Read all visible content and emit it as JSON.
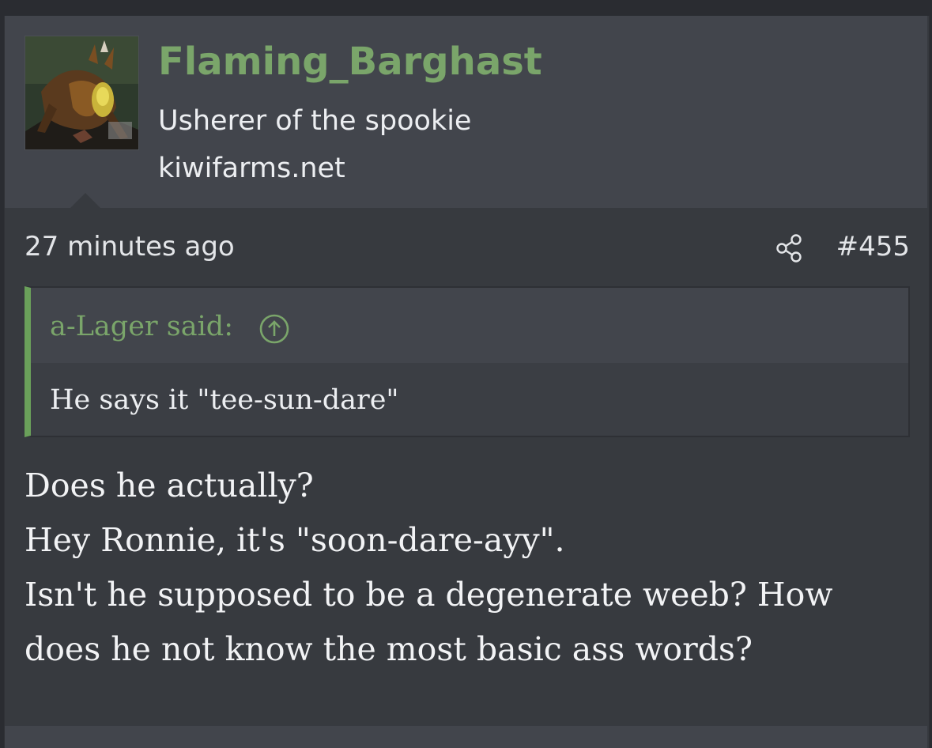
{
  "user": {
    "username": "Flaming_Barghast",
    "title": "Usherer of the spookie",
    "site": "kiwifarms.net",
    "avatar_icon": "avatar-creature-image"
  },
  "post": {
    "timestamp": "27 minutes ago",
    "share_icon": "share-icon",
    "number": "#455",
    "quote": {
      "author_label": "a-Lager said:",
      "jump_icon": "arrow-up-circle-icon",
      "text": "He says it \"tee-sun-dare\""
    },
    "body_lines": [
      "Does he actually?",
      "Hey Ronnie, it's \"soon-dare-ayy\".",
      "Isn't he supposed to be a degenerate weeb? How",
      "does he not know the most basic ass words?"
    ]
  },
  "colors": {
    "accent": "#7aa56a",
    "quote_bar": "#6aa05a",
    "background": "#373a3f",
    "header_bg": "#42454c",
    "text": "#f2f3f5"
  }
}
